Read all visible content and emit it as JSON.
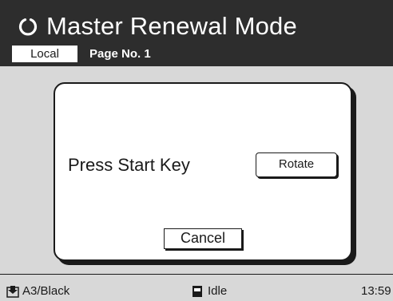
{
  "header": {
    "title": "Master Renewal Mode",
    "mode_icon": "circle-arrow-icon",
    "local_label": "Local",
    "page_label": "Page No. 1"
  },
  "dialog": {
    "message": "Press Start Key",
    "rotate_label": "Rotate",
    "cancel_label": "Cancel"
  },
  "status": {
    "paper": "A3/Black",
    "paper_icon": "tray-icon",
    "state": "Idle",
    "state_icon": "machine-status-icon",
    "time": "13:59"
  },
  "colors": {
    "header_bg": "#2d2d2d",
    "screen_bg": "#d8d8d8",
    "dialog_bg": "#ffffff",
    "ink": "#1a1a1a"
  }
}
